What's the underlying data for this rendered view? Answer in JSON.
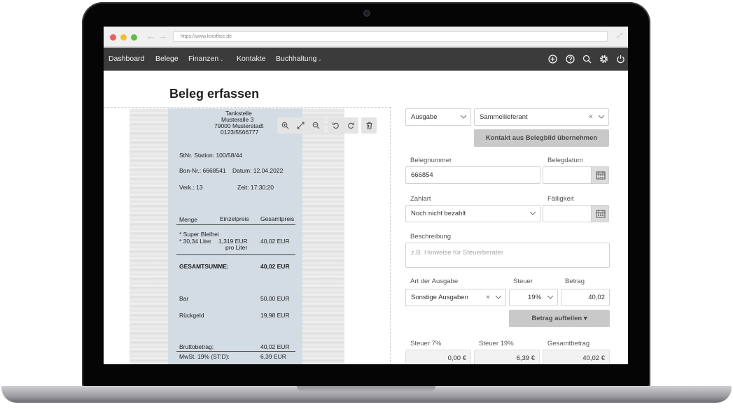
{
  "browser": {
    "url": "https://www.lexoffice.de",
    "back_arrow": "←",
    "forward_arrow": "→",
    "expand_glyph": "⤢"
  },
  "nav": {
    "items": [
      {
        "label": "Dashboard",
        "has_caret": false
      },
      {
        "label": "Belege",
        "has_caret": false
      },
      {
        "label": "Finanzen",
        "has_caret": true
      },
      {
        "label": "Kontakte",
        "has_caret": false
      },
      {
        "label": "Buchhaltung",
        "has_caret": true
      }
    ],
    "caret": "⌄",
    "icons": [
      "plus-circle-icon",
      "help-icon",
      "search-icon",
      "gear-icon",
      "power-icon"
    ]
  },
  "page": {
    "title": "Beleg erfassen"
  },
  "receipt": {
    "header": [
      "Tankstelle",
      "Musteralle 3",
      "79000 Musterstadt",
      "0123/5566777"
    ],
    "station": "StNr. Station: 100/58/44",
    "bon": "Bon-Nr.: 6668541",
    "datum": "Datum: 12.04.2022",
    "verk": "Verk.: 13",
    "zeit": "Zeit: 17:30:20",
    "col_menge": "Menge",
    "col_einzel": "Einzelpreis",
    "col_gesamt": "Gesamtpreis",
    "item_name": "* Super Bleifrei",
    "item_qty": "* 30,34 Liter",
    "item_unit_price": "1,319 EUR",
    "item_unit": "pro Liter",
    "item_total": "40,02 EUR",
    "sum_label": "GESAMTSUMME:",
    "sum_value": "40,02 EUR",
    "bar_label": "Bar",
    "bar_value": "50,00 EUR",
    "rueck_label": "Rückgeld",
    "rueck_value": "19,98 EUR",
    "brutto_label": "Bruttobetrag:",
    "brutto_value": "40,02 EUR",
    "mwst_label": "MwSt. 19% (ST:D):",
    "mwst_value": "6,39 EUR"
  },
  "tools": [
    "zoom-in-icon",
    "fullscreen-icon",
    "zoom-out-icon",
    "rotate-left-icon",
    "rotate-right-icon",
    "trash-icon"
  ],
  "form": {
    "type_value": "Ausgabe",
    "contact_value": "Sammellieferant",
    "clear_glyph": "×",
    "contact_button": "Kontakt aus Belegbild übernehmen",
    "belegnummer_label": "Belegnummer",
    "belegnummer_value": "666854",
    "belegdatum_label": "Belegdatum",
    "zahlart_label": "Zahlart",
    "zahlart_value": "Noch nicht bezahlt",
    "faelligkeit_label": "Fälligkeit",
    "beschreibung_label": "Beschreibung",
    "beschreibung_placeholder": "z.B. Hinweise für Steuerberater",
    "art_label": "Art der Ausgabe",
    "art_value": "Sonstige Ausgaben",
    "steuer_label": "Steuer",
    "steuer_value": "19%",
    "betrag_label": "Betrag",
    "betrag_value": "40,02",
    "split_button": "Betrag aufteilen ▾",
    "steuer7_label": "Steuer 7%",
    "steuer7_value": "0,00 €",
    "steuer19_label": "Steuer 19%",
    "steuer19_value": "6,39 €",
    "gesamt_label": "Gesamtbetrag",
    "gesamt_value": "40,02 €"
  }
}
